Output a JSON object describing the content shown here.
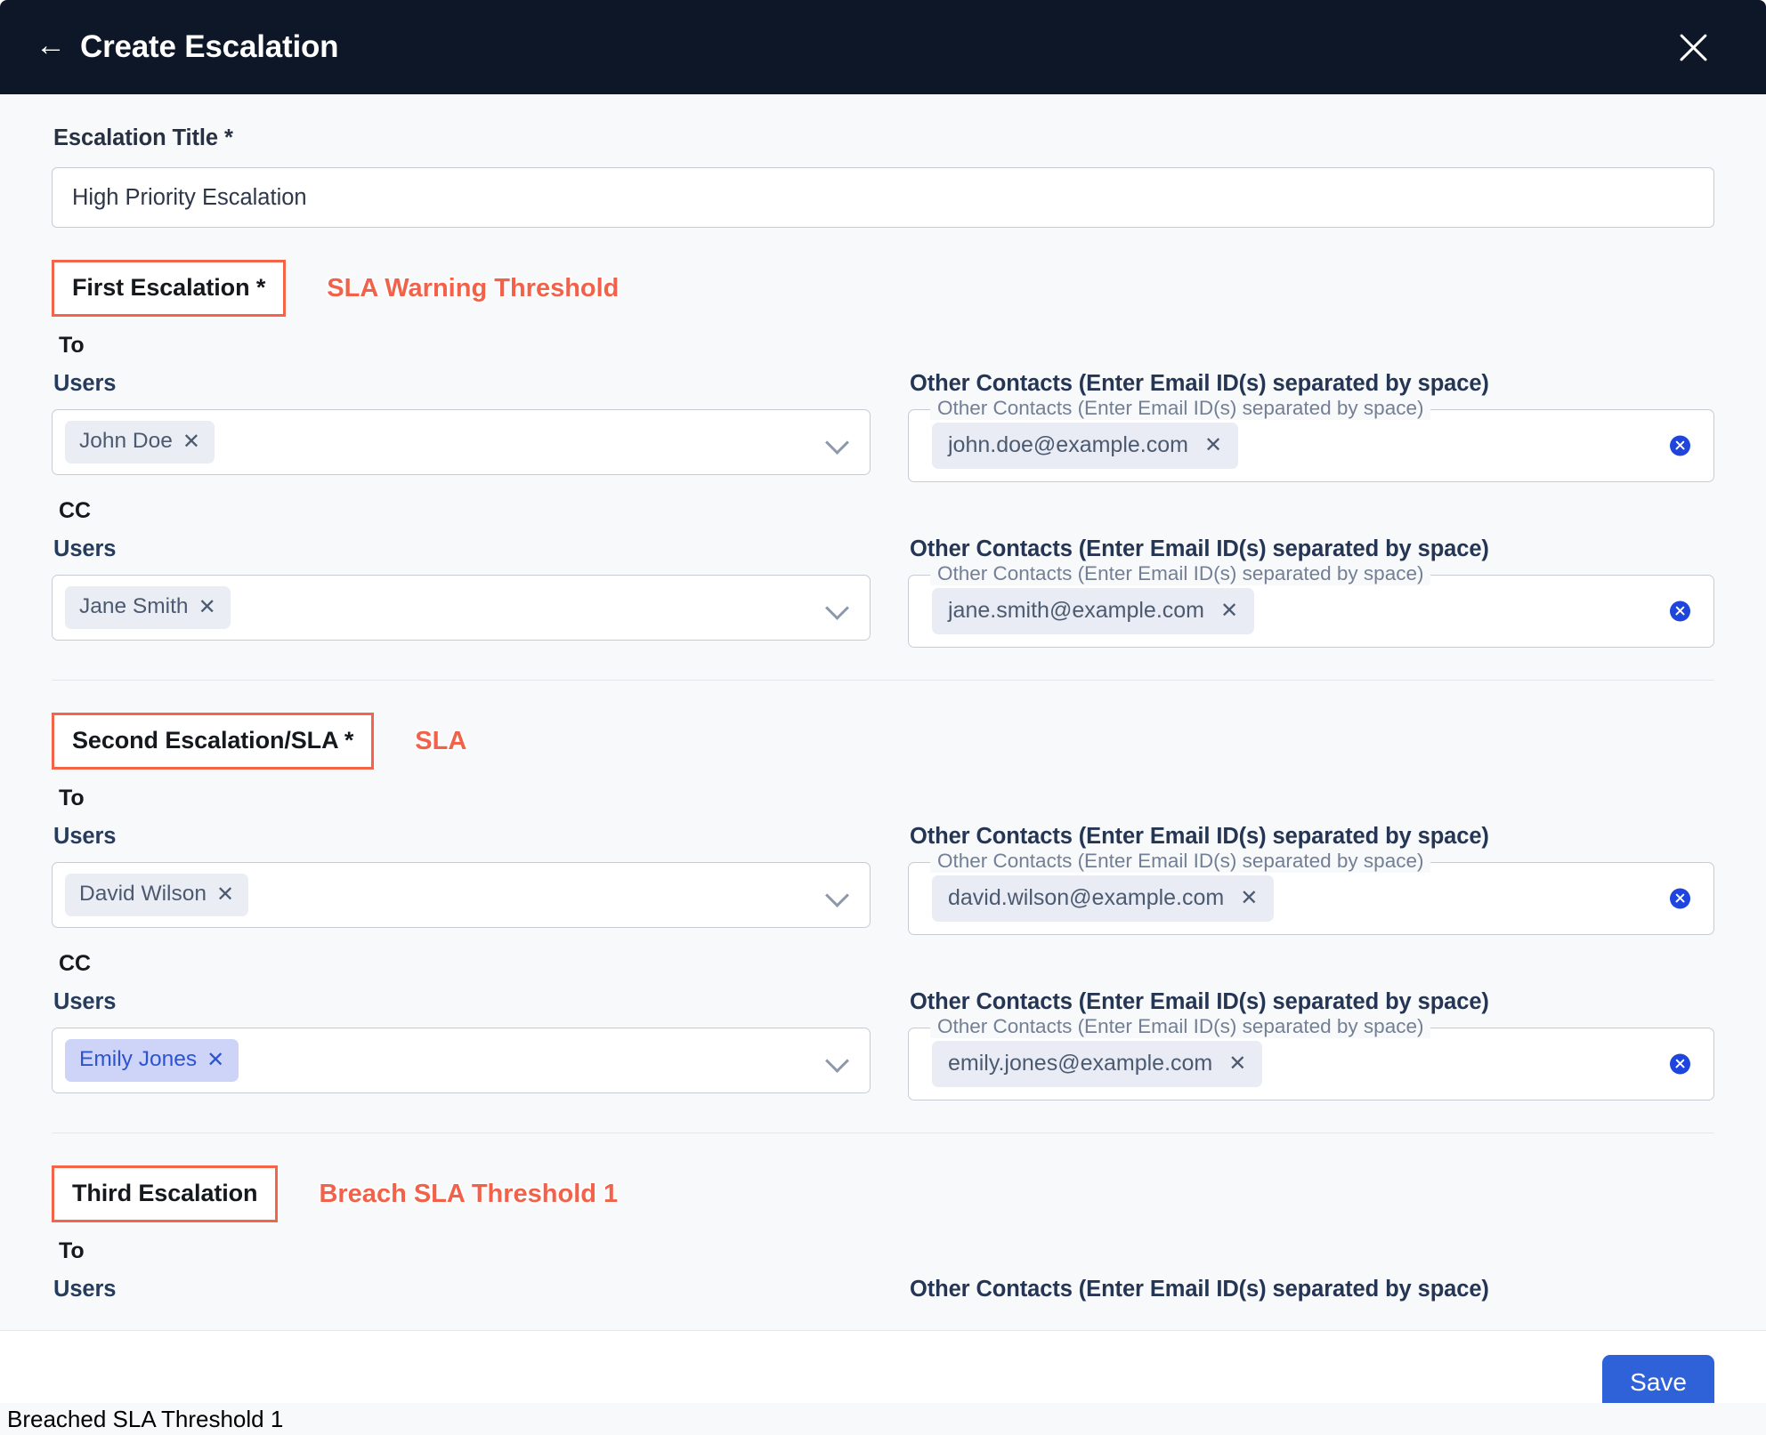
{
  "header": {
    "back_icon": "arrow-left-icon",
    "title": "Create Escalation",
    "close_icon": "close-icon"
  },
  "form": {
    "title_field": {
      "label": "Escalation Title *",
      "value": "High Priority Escalation",
      "placeholder": "Escalation Title"
    },
    "shared": {
      "to_label": "To",
      "cc_label": "CC",
      "users_label": "Users",
      "other_contacts_label": "Other Contacts (Enter Email ID(s) separated by space)",
      "other_contacts_legend": "Other Contacts (Enter Email ID(s) separated by space)",
      "chip_remove": "✕",
      "chevron_icon": "chevron-down-icon",
      "clear_icon": "clear-circle-icon"
    },
    "sections": [
      {
        "title": "First Escalation *",
        "annotation": "SLA Warning Threshold",
        "to": {
          "users": [
            {
              "name": "John Doe",
              "highlight": false
            }
          ],
          "emails": [
            {
              "value": "john.doe@example.com"
            }
          ]
        },
        "cc": {
          "users": [
            {
              "name": "Jane Smith",
              "highlight": false
            }
          ],
          "emails": [
            {
              "value": "jane.smith@example.com"
            }
          ]
        }
      },
      {
        "title": "Second Escalation/SLA *",
        "annotation": "SLA",
        "to": {
          "users": [
            {
              "name": "David Wilson",
              "highlight": false
            }
          ],
          "emails": [
            {
              "value": "david.wilson@example.com"
            }
          ]
        },
        "cc": {
          "users": [
            {
              "name": "Emily Jones",
              "highlight": true
            }
          ],
          "emails": [
            {
              "value": "emily.jones@example.com"
            }
          ]
        }
      },
      {
        "title": "Third Escalation",
        "annotation": "Breach SLA Threshold 1",
        "to": {
          "users": [],
          "emails": []
        },
        "cc": null
      }
    ]
  },
  "footer": {
    "save_label": "Save"
  },
  "caption": {
    "text": "Breached SLA Threshold 1"
  },
  "colors": {
    "header_bg": "#0d1727",
    "annotation": "#f2614a",
    "annotation_box_border": "#f26549",
    "accent_blue": "#2f62d8",
    "clear_blue": "#1f45dd",
    "chip_bg": "#eaedf4",
    "chip_highlight_bg": "#cdd4f8",
    "chip_highlight_text": "#2d53cf",
    "page_bg": "#f8f9fb"
  }
}
